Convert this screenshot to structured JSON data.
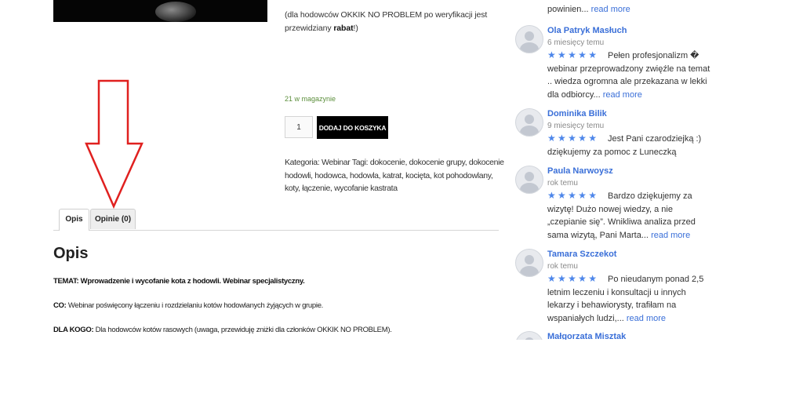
{
  "product": {
    "note_prefix": "(dla hodowców OKKIK NO PROBLEM po weryfikacji jest przewidziany ",
    "note_bold": "rabat",
    "note_suffix": "!)",
    "stock": "21 w magazynie",
    "quantity": "1",
    "add_to_cart": "DODAJ DO KOSZYKA",
    "meta_category_label": "Kategoria:",
    "meta_category": "Webinar",
    "meta_tags_label": "Tagi:",
    "meta_tags": "dokocenie, dokocenie grupy, dokocenie hodowli, hodowca, hodowla, katrat, kocięta, kot pohodowlany, koty, łączenie, wycofanie kastrata"
  },
  "tabs": [
    {
      "label": "Opis"
    },
    {
      "label": "Opinie (0)"
    }
  ],
  "description": {
    "title": "Opis",
    "temat_label": "TEMAT:",
    "temat_text": "Wprowadzenie i wycofanie kota z hodowli. Webinar specjalistyczny.",
    "co_label": "CO:",
    "co_text": "Webinar poświęcony łączeniu i rozdzielaniu kotów hodowlanych żyjących w grupie.",
    "dla_label": "DLA KOGO:",
    "dla_text": "Dla hodowców kotów rasowych (uwaga, przewiduję zniżki dla członków OKKIK NO PROBLEM)."
  },
  "reviews": {
    "top_partial": "powinien...",
    "read_more": "read more",
    "stars": "★★★★★",
    "items": [
      {
        "name": "Ola Patryk Masłuch",
        "time": "6 miesięcy temu",
        "text": "Pełen profesjonalizm � webinar przeprowadzony zwięźle na temat .. wiedza ogromna ale przekazana w lekki dla odbiorcy...",
        "more": true
      },
      {
        "name": "Dominika Bilik",
        "time": "9 miesięcy temu",
        "text": "Jest Pani czarodziejką :) dziękujemy za pomoc z Luneczką",
        "more": false
      },
      {
        "name": "Paula Narwoysz",
        "time": "rok temu",
        "text": "Bardzo dziękujemy za wizytę! Dużo nowej wiedzy, a nie „czepianie się”. Wnikliwa analiza przed sama wizytą, Pani Marta...",
        "more": true
      },
      {
        "name": "Tamara Szczekot",
        "time": "rok temu",
        "text": "Po nieudanym ponad 2,5 letnim  leczeniu i konsultacji u innych lekarzy i behawiorysty, trafiłam na wspaniałych ludzi,...",
        "more": true
      },
      {
        "name": "Małgorzata Misztak",
        "time": "",
        "text": "",
        "more": false
      }
    ]
  },
  "colors": {
    "accent_link": "#3a6fd8",
    "star": "#4d86ea",
    "stock_green": "#5b8e3b",
    "arrow_red": "#e0201f"
  }
}
